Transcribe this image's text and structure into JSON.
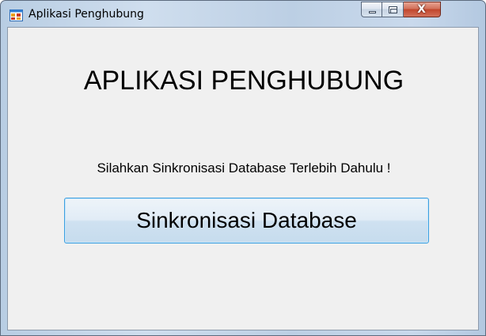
{
  "window": {
    "title": "Aplikasi Penghubung",
    "icon": "application-window-icon",
    "controls": {
      "minimize_icon": "minimize-icon",
      "maximize_icon": "maximize-icon",
      "close_glyph": "X",
      "close_color": "#c1462c"
    }
  },
  "main": {
    "heading": "APLIKASI PENGHUBUNG",
    "prompt": "Silahkan Sinkronisasi Database Terlebih Dahulu !",
    "sync_button_label": "Sinkronisasi Database"
  },
  "colors": {
    "client_background": "#f0f0f0",
    "button_focus_border": "#3c9fdf"
  }
}
